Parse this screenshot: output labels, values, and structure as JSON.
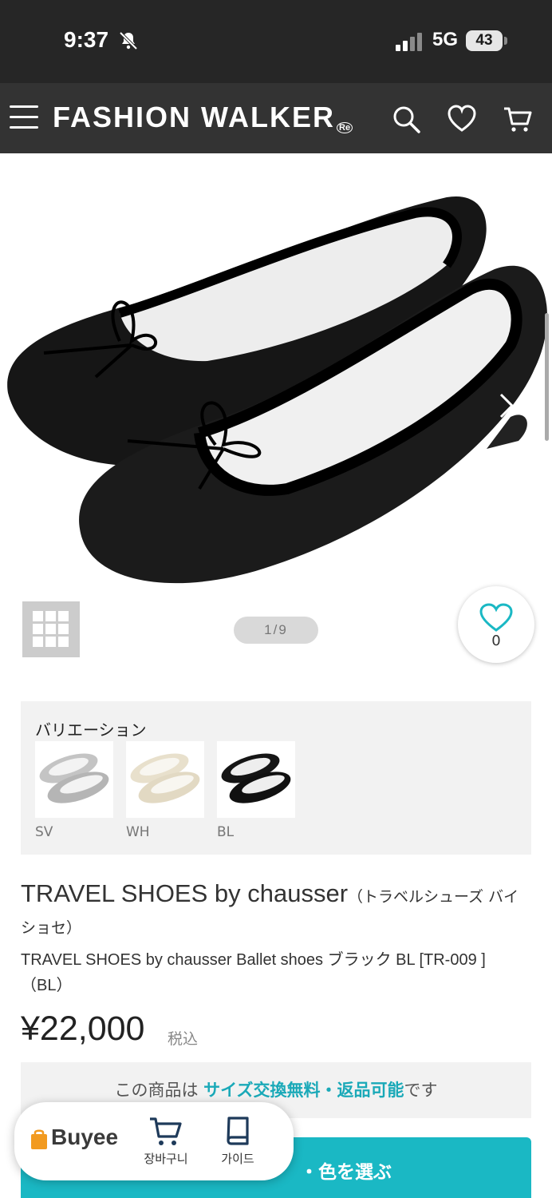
{
  "status_bar": {
    "time": "9:37",
    "network": "5G",
    "battery": "43"
  },
  "header": {
    "brand": "FASHION WALKER",
    "brand_mark": "Re"
  },
  "gallery": {
    "page_counter": "1/9",
    "favorite_count": "0"
  },
  "variation": {
    "title": "バリエーション",
    "items": [
      {
        "code": "SV",
        "color": "#c9c9c9"
      },
      {
        "code": "WH",
        "color": "#ede6d6"
      },
      {
        "code": "BL",
        "color": "#151515"
      }
    ]
  },
  "product": {
    "title": "TRAVEL SHOES by chausser",
    "title_kana": "（トラベルシューズ バイ ショセ）",
    "subtitle": "TRAVEL SHOES by chausser Ballet shoes ブラック BL [TR-009 ] （BL）",
    "price": "¥22,000",
    "tax_label": "税込"
  },
  "notice": {
    "prefix": "この商品は",
    "highlight": "サイズ交換無料・返品可能",
    "suffix": "です"
  },
  "select_bar": {
    "label": "・色を選ぶ"
  },
  "buyee": {
    "logo": "Buyee",
    "cart_label": "장바구니",
    "guide_label": "가이드"
  },
  "colors": {
    "header_bg": "#333333",
    "accent": "#1ab8c4"
  }
}
